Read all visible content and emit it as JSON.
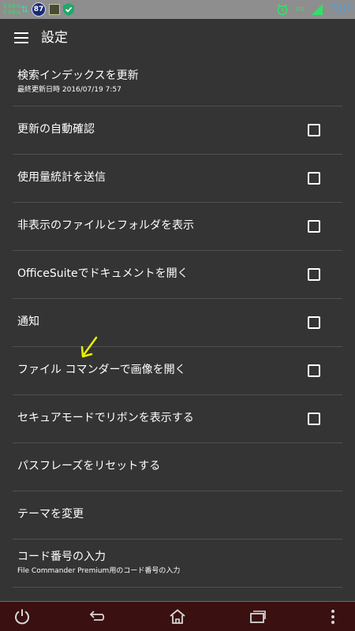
{
  "status_bar": {
    "net_speed": "0 KB/s\n0 KB/s",
    "battery_badge": "87",
    "network_type": "LTE",
    "time": "7/19 (火)\n7:57",
    "icons": [
      "data-arrows-icon",
      "app-icon",
      "shield-check-icon",
      "alarm-icon",
      "signal-icon"
    ]
  },
  "app_bar": {
    "menu_icon": "hamburger-menu-icon",
    "title": "設定"
  },
  "settings": [
    {
      "label": "検索インデックスを更新",
      "sub": "最終更新日時 2016/07/19 7:57",
      "checkbox": false
    },
    {
      "label": "更新の自動確認",
      "checkbox": true,
      "checked": false
    },
    {
      "label": "使用量統計を送信",
      "checkbox": true,
      "checked": false
    },
    {
      "label": "非表示のファイルとフォルダを表示",
      "checkbox": true,
      "checked": false
    },
    {
      "label": "OfficeSuiteでドキュメントを開く",
      "checkbox": true,
      "checked": false
    },
    {
      "label": "通知",
      "checkbox": true,
      "checked": false
    },
    {
      "label": "ファイル コマンダーで画像を開く",
      "checkbox": true,
      "checked": false
    },
    {
      "label": "セキュアモードでリボンを表示する",
      "checkbox": true,
      "checked": false
    },
    {
      "label": "パスフレーズをリセットする",
      "checkbox": false
    },
    {
      "label": "テーマを変更",
      "checkbox": false
    },
    {
      "label": "コード番号の入力",
      "sub": "File Commander Premium用のコード番号の入力",
      "checkbox": false
    }
  ],
  "annotation": {
    "arrow_color": "#e8f000"
  },
  "nav_bar": {
    "icons": [
      "power-icon",
      "back-icon",
      "home-icon",
      "recents-icon",
      "overflow-menu-icon"
    ]
  }
}
